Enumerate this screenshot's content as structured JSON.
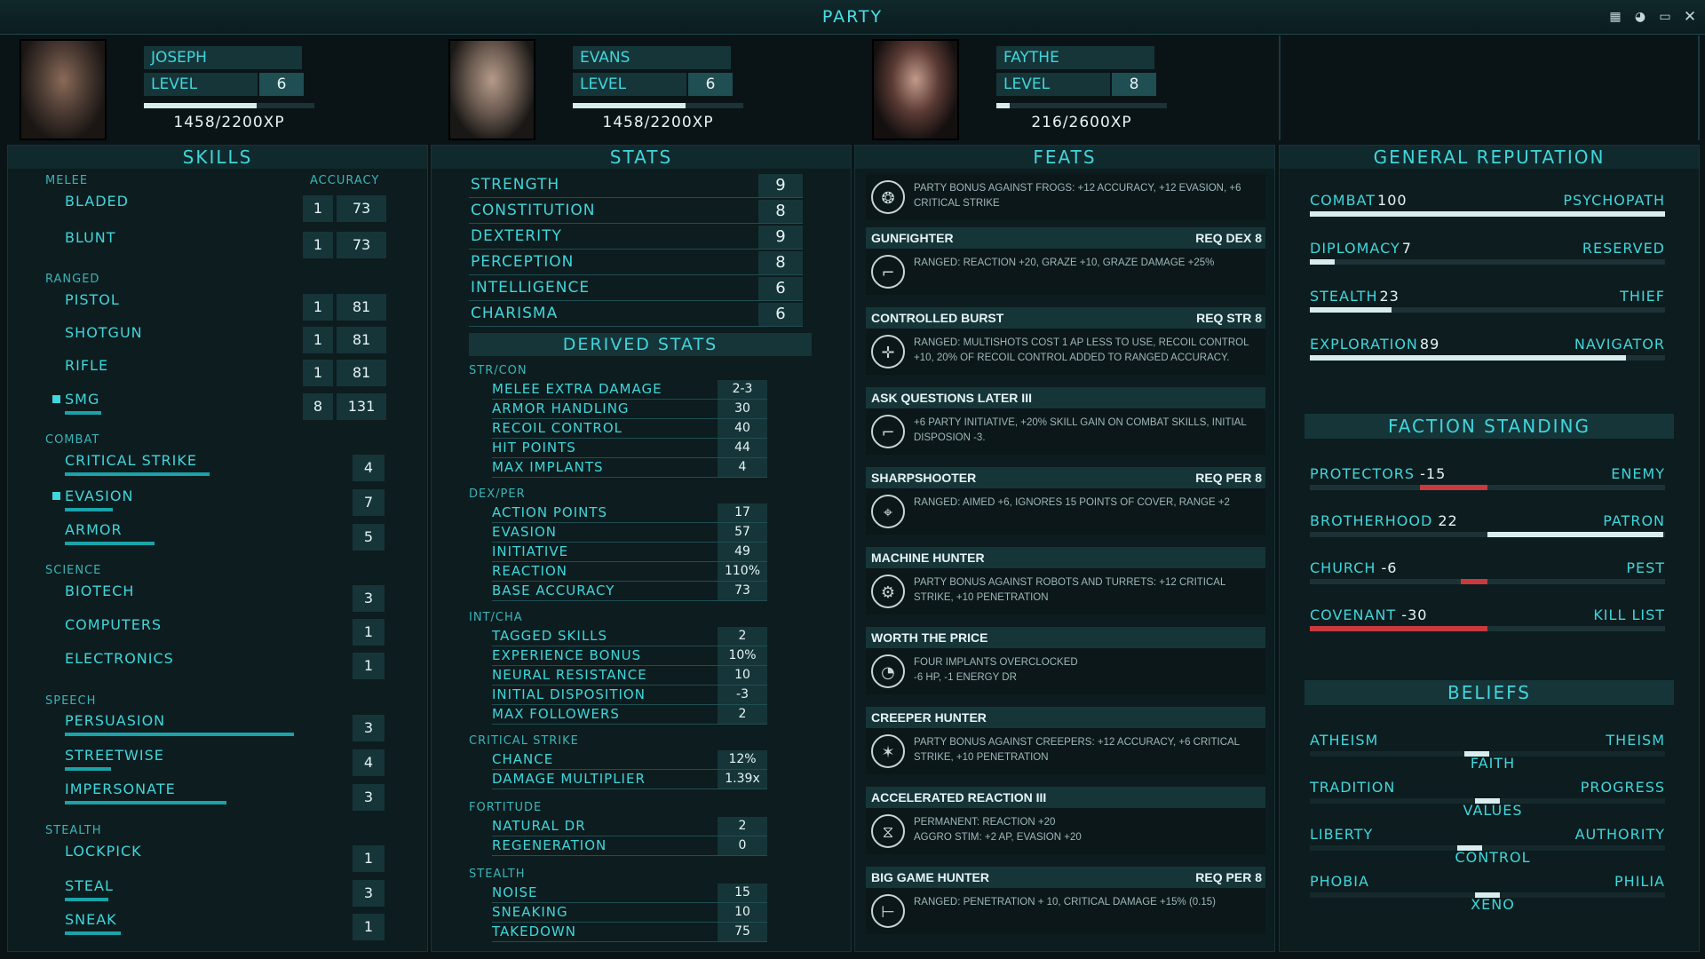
{
  "window": {
    "title": "PARTY"
  },
  "characters": [
    {
      "name": "JOSEPH",
      "level_label": "LEVEL",
      "level": "6",
      "xp_text": "1458/2200XP",
      "xp_fraction": 0.66
    },
    {
      "name": "EVANS",
      "level_label": "LEVEL",
      "level": "6",
      "xp_text": "1458/2200XP",
      "xp_fraction": 0.66
    },
    {
      "name": "FAYTHE",
      "level_label": "LEVEL",
      "level": "8",
      "xp_text": "216/2600XP",
      "xp_fraction": 0.08
    }
  ],
  "skills": {
    "title": "SKILLS",
    "accuracy_label": "ACCURACY",
    "categories": {
      "melee": "MELEE",
      "ranged": "RANGED",
      "combat": "COMBAT",
      "science": "SCIENCE",
      "speech": "SPEECH",
      "stealth": "STEALTH"
    },
    "items": {
      "bladed": {
        "label": "BLADED",
        "rank": "1",
        "accuracy": "73"
      },
      "blunt": {
        "label": "BLUNT",
        "rank": "1",
        "accuracy": "73"
      },
      "pistol": {
        "label": "PISTOL",
        "rank": "1",
        "accuracy": "81"
      },
      "shotgun": {
        "label": "SHOTGUN",
        "rank": "1",
        "accuracy": "81"
      },
      "rifle": {
        "label": "RIFLE",
        "rank": "1",
        "accuracy": "81"
      },
      "smg": {
        "label": "SMG",
        "rank": "8",
        "accuracy": "131",
        "level": 0.15
      },
      "critical_strike": {
        "label": "CRITICAL STRIKE",
        "value": "4",
        "level": 0.6
      },
      "evasion": {
        "label": "EVASION",
        "value": "7",
        "level": 0.2
      },
      "armor": {
        "label": "ARMOR",
        "value": "5",
        "level": 0.37
      },
      "biotech": {
        "label": "BIOTECH",
        "value": "3"
      },
      "computers": {
        "label": "COMPUTERS",
        "value": "1"
      },
      "electronics": {
        "label": "ELECTRONICS",
        "value": "1"
      },
      "persuasion": {
        "label": "PERSUASION",
        "value": "3",
        "level": 0.95
      },
      "streetwise": {
        "label": "STREETWISE",
        "value": "4",
        "level": 0.19
      },
      "impersonate": {
        "label": "IMPERSONATE",
        "value": "3",
        "level": 0.67
      },
      "lockpick": {
        "label": "LOCKPICK",
        "value": "1"
      },
      "steal": {
        "label": "STEAL",
        "value": "3",
        "level": 0.18
      },
      "sneak": {
        "label": "SNEAK",
        "value": "1",
        "level": 0.23
      }
    }
  },
  "stats": {
    "title": "STATS",
    "strength": {
      "label": "STRENGTH",
      "value": "9"
    },
    "constitution": {
      "label": "CONSTITUTION",
      "value": "8"
    },
    "dexterity": {
      "label": "DEXTERITY",
      "value": "9"
    },
    "perception": {
      "label": "PERCEPTION",
      "value": "8"
    },
    "intelligence": {
      "label": "INTELLIGENCE",
      "value": "6"
    },
    "charisma": {
      "label": "CHARISMA",
      "value": "6"
    }
  },
  "derived": {
    "title": "DERIVED STATS",
    "cat_strcon": "STR/CON",
    "melee_extra_damage": {
      "label": "MELEE EXTRA DAMAGE",
      "value": "2-3"
    },
    "armor_handling": {
      "label": "ARMOR HANDLING",
      "value": "30"
    },
    "recoil_control": {
      "label": "RECOIL CONTROL",
      "value": "40"
    },
    "hit_points": {
      "label": "HIT POINTS",
      "value": "44"
    },
    "max_implants": {
      "label": "MAX IMPLANTS",
      "value": "4"
    },
    "cat_dexper": "DEX/PER",
    "action_points": {
      "label": "ACTION POINTS",
      "value": "17"
    },
    "evasion": {
      "label": "EVASION",
      "value": "57"
    },
    "initiative": {
      "label": "INITIATIVE",
      "value": "49"
    },
    "reaction": {
      "label": "REACTION",
      "value": "110%"
    },
    "base_accuracy": {
      "label": "BASE ACCURACY",
      "value": "73"
    },
    "cat_intcha": "INT/CHA",
    "tagged_skills": {
      "label": "TAGGED SKILLS",
      "value": "2"
    },
    "experience_bonus": {
      "label": "EXPERIENCE BONUS",
      "value": "10%"
    },
    "neural_resistance": {
      "label": "NEURAL RESISTANCE",
      "value": "10"
    },
    "initial_disposition": {
      "label": "INITIAL DISPOSITION",
      "value": "-3"
    },
    "max_followers": {
      "label": "MAX FOLLOWERS",
      "value": "2"
    },
    "cat_crit": "CRITICAL STRIKE",
    "chance": {
      "label": "CHANCE",
      "value": "12%"
    },
    "damage_multiplier": {
      "label": "DAMAGE MULTIPLIER",
      "value": "1.39x"
    },
    "cat_fortitude": "FORTITUDE",
    "natural_dr": {
      "label": "NATURAL DR",
      "value": "2"
    },
    "regeneration": {
      "label": "REGENERATION",
      "value": "0"
    },
    "cat_stealth": "STEALTH",
    "noise": {
      "label": "NOISE",
      "value": "15"
    },
    "sneaking": {
      "label": "SNEAKING",
      "value": "10"
    },
    "takedown": {
      "label": "TAKEDOWN",
      "value": "75"
    }
  },
  "feats": {
    "title": "FEATS",
    "items": [
      {
        "name": "",
        "req": "",
        "icon": "frog-target-icon",
        "glyph": "❂",
        "desc": "PARTY BONUS AGAINST FROGS: +12 ACCURACY, +12 EVASION, +6 CRITICAL STRIKE"
      },
      {
        "name": "GUNFIGHTER",
        "req": "REQ DEX 8",
        "icon": "pistol-icon",
        "glyph": "⌐",
        "desc": "RANGED: REACTION +20, GRAZE +10, GRAZE DAMAGE +25%"
      },
      {
        "name": "CONTROLLED BURST",
        "req": "REQ STR 8",
        "icon": "burst-icon",
        "glyph": "✛",
        "desc": "RANGED: MULTISHOTS COST 1 AP LESS TO USE, RECOIL CONTROL +10, 20% OF RECOIL CONTROL ADDED TO RANGED ACCURACY."
      },
      {
        "name": "ASK QUESTIONS LATER III",
        "req": "",
        "icon": "gun-icon",
        "glyph": "⌐",
        "desc": "+6 PARTY INITIATIVE, +20% SKILL GAIN ON COMBAT SKILLS, INITIAL DISPOSION -3."
      },
      {
        "name": "SHARPSHOOTER",
        "req": "REQ PER 8",
        "icon": "crosshair-icon",
        "glyph": "⌖",
        "desc": "RANGED: AIMED +6, IGNORES 15 POINTS OF COVER, RANGE +2"
      },
      {
        "name": "MACHINE HUNTER",
        "req": "",
        "icon": "robot-target-icon",
        "glyph": "⚙",
        "desc": "PARTY BONUS AGAINST ROBOTS AND TURRETS: +12 CRITICAL STRIKE, +10 PENETRATION"
      },
      {
        "name": "WORTH THE PRICE",
        "req": "",
        "icon": "gauge-icon",
        "glyph": "◔",
        "desc": "FOUR IMPLANTS OVERCLOCKED\n-6 HP, -1 ENERGY DR"
      },
      {
        "name": "CREEPER HUNTER",
        "req": "",
        "icon": "creeper-target-icon",
        "glyph": "✶",
        "desc": "PARTY BONUS AGAINST CREEPERS: +12 ACCURACY, +6 CRITICAL STRIKE, +10 PENETRATION"
      },
      {
        "name": "ACCELERATED REACTION III",
        "req": "",
        "icon": "dna-icon",
        "glyph": "⧖",
        "desc": "PERMANENT: REACTION +20\nAGGRO STIM: +2 AP, EVASION +20"
      },
      {
        "name": "BIG GAME HUNTER",
        "req": "REQ PER 8",
        "icon": "rifle-icon",
        "glyph": "⊢",
        "desc": "RANGED: PENETRATION + 10, CRITICAL DAMAGE +15% (0.15)"
      }
    ]
  },
  "reputation": {
    "title": "GENERAL REPUTATION",
    "items": [
      {
        "label": "COMBAT",
        "value": "100",
        "right": "PSYCHOPATH",
        "level": 1.0
      },
      {
        "label": "DIPLOMACY",
        "value": "7",
        "right": "RESERVED",
        "level": 0.07
      },
      {
        "label": "STEALTH",
        "value": "23",
        "right": "THIEF",
        "level": 0.23
      },
      {
        "label": "EXPLORATION",
        "value": "89",
        "right": "NAVIGATOR",
        "level": 0.89
      }
    ]
  },
  "factions": {
    "title": "FACTION STANDING",
    "items": [
      {
        "label": "PROTECTORS",
        "value": "-15",
        "right": "ENEMY",
        "level": -0.38,
        "color": "#c83a3e"
      },
      {
        "label": "BROTHERHOOD",
        "value": "22",
        "right": "PATRON",
        "level": 0.99,
        "color": "#d9ecee"
      },
      {
        "label": "CHURCH",
        "value": "-6",
        "right": "PEST",
        "level": -0.15,
        "color": "#c83a3e"
      },
      {
        "label": "COVENANT",
        "value": "-30",
        "right": "KILL LIST",
        "level": -1.0,
        "color": "#c83a3e"
      }
    ]
  },
  "beliefs": {
    "title": "BELIEFS",
    "items": [
      {
        "left": "ATHEISM",
        "right": "THEISM",
        "mid": "FAITH",
        "level": -0.06
      },
      {
        "left": "TRADITION",
        "right": "PROGRESS",
        "mid": "VALUES",
        "level": 0.0
      },
      {
        "left": "LIBERTY",
        "right": "AUTHORITY",
        "mid": "CONTROL",
        "level": -0.1
      },
      {
        "left": "PHOBIA",
        "right": "PHILIA",
        "mid": "XENO",
        "level": 0.0
      }
    ]
  },
  "colors": {
    "accent": "#3fd6dc",
    "panel": "#163539",
    "negative": "#c83a3e",
    "bar": "#1aa3aa"
  }
}
